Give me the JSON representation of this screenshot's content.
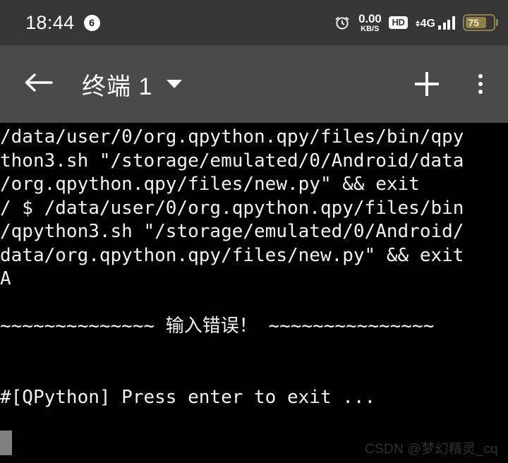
{
  "status_bar": {
    "time": "18:44",
    "notification_count": "6",
    "alarm_icon": "alarm-clock-icon",
    "network_speed_value": "0.00",
    "network_speed_unit": "KB/S",
    "hd_badge": "HD",
    "network_generation": "4G",
    "signal_bars": 4,
    "battery_level": "75",
    "colors": {
      "background": "#363636",
      "battery": "#8e8048"
    }
  },
  "app_bar": {
    "back_icon": "back-arrow-icon",
    "title": "终端 1",
    "dropdown_icon": "chevron-down-icon",
    "add_icon": "plus-icon",
    "overflow_icon": "more-vertical-icon",
    "colors": {
      "background": "#4a4a4a",
      "foreground": "#ffffff"
    }
  },
  "terminal": {
    "colors": {
      "background": "#000000",
      "text": "#f2f2f2",
      "cursor": "#808080"
    },
    "lines": [
      "/data/user/0/org.qpython.qpy/files/bin/qpy",
      "thon3.sh \"/storage/emulated/0/Android/data",
      "/org.qpython.qpy/files/new.py\" && exit",
      "/ $ /data/user/0/org.qpython.qpy/files/bin",
      "/qpython3.sh \"/storage/emulated/0/Android/",
      "data/org.qpython.qpy/files/new.py\" && exit",
      "A",
      "",
      "~~~~~~~~~~~~~~ 输入错误！ ~~~~~~~~~~~~~~~",
      "",
      "",
      "#[QPython] Press enter to exit ..."
    ]
  },
  "watermark": {
    "text": "CSDN @梦幻精灵_cq"
  }
}
